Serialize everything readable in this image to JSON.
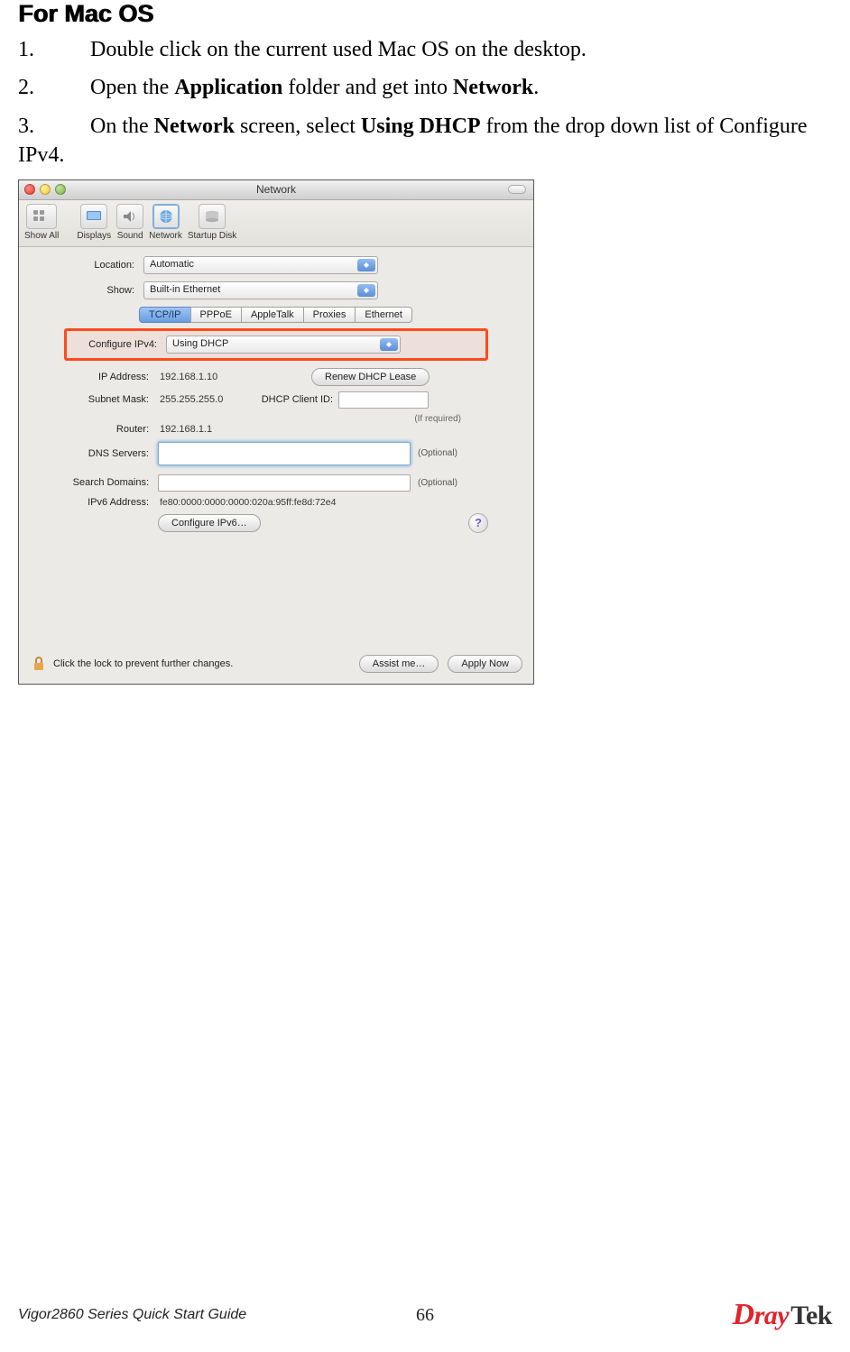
{
  "heading": "For Mac OS",
  "steps": {
    "s1_num": "1.",
    "s1_text": "Double click on the current used Mac OS on the desktop.",
    "s2_num": "2.",
    "s2_text_a": "Open the ",
    "s2_text_b": "Application",
    "s2_text_c": " folder and get into ",
    "s2_text_d": "Network",
    "s2_text_e": ".",
    "s3_num": "3.",
    "s3_text_a": "On the ",
    "s3_text_b": "Network",
    "s3_text_c": " screen, select ",
    "s3_text_d": "Using DHCP",
    "s3_text_e": " from the drop down list of Configure IPv4."
  },
  "window": {
    "title": "Network",
    "toolbar": {
      "show_all": "Show All",
      "displays": "Displays",
      "sound": "Sound",
      "network": "Network",
      "startup_disk": "Startup Disk"
    },
    "labels": {
      "location": "Location:",
      "show": "Show:",
      "configure_ipv4": "Configure IPv4:",
      "ip_address": "IP Address:",
      "subnet_mask": "Subnet Mask:",
      "router": "Router:",
      "dhcp_client_id": "DHCP Client ID:",
      "if_required": "(If required)",
      "dns_servers": "DNS Servers:",
      "search_domains": "Search Domains:",
      "ipv6_address": "IPv6 Address:",
      "optional": "(Optional)"
    },
    "values": {
      "location": "Automatic",
      "show": "Built-in Ethernet",
      "configure_ipv4": "Using DHCP",
      "ip_address": "192.168.1.10",
      "subnet_mask": "255.255.255.0",
      "router": "192.168.1.1",
      "ipv6_address": "fe80:0000:0000:0000:020a:95ff:fe8d:72e4"
    },
    "tabs": {
      "tcpip": "TCP/IP",
      "pppoe": "PPPoE",
      "appletalk": "AppleTalk",
      "proxies": "Proxies",
      "ethernet": "Ethernet"
    },
    "buttons": {
      "renew": "Renew DHCP Lease",
      "configure_ipv6": "Configure IPv6…",
      "assist": "Assist me…",
      "apply": "Apply Now",
      "help": "?"
    },
    "lock_text": "Click the lock to prevent further changes."
  },
  "footer": {
    "guide": "Vigor2860 Series Quick Start Guide",
    "page": "66",
    "brand_d": "D",
    "brand_ray": "ray",
    "brand_tek": "Tek"
  }
}
